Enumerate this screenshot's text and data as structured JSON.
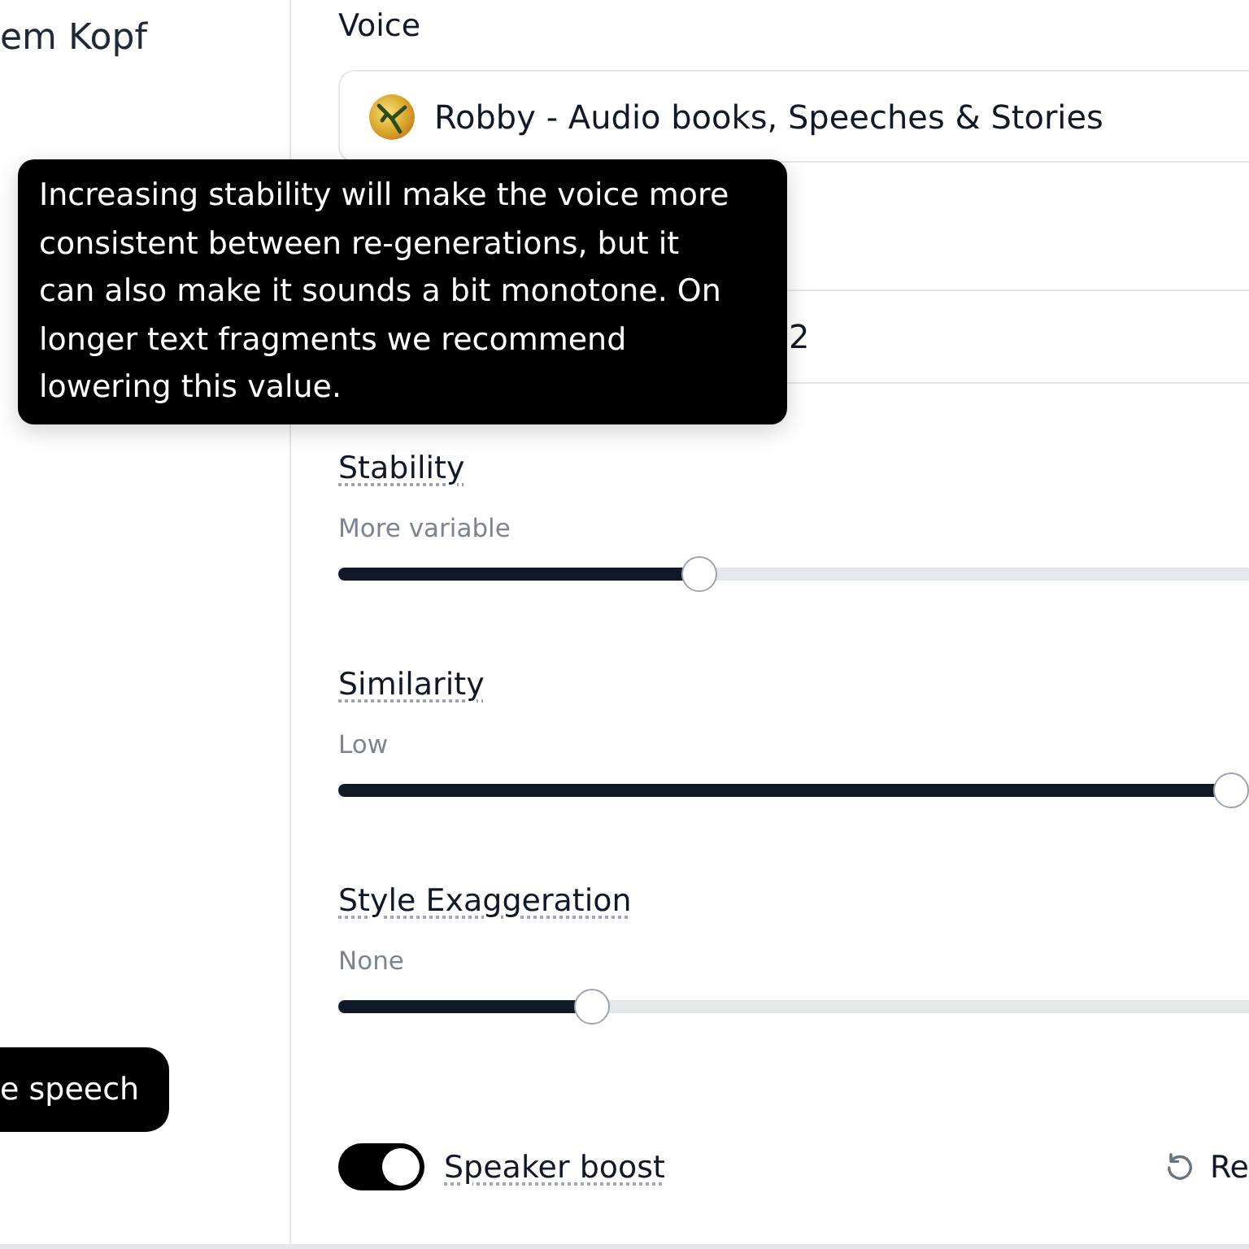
{
  "sidebar": {
    "heading": "em Kopf",
    "button": "e speech"
  },
  "voice": {
    "label": "Voice",
    "value": "Robby - Audio books, Speeches & Stories"
  },
  "model_field": {
    "value": "2"
  },
  "sliders": [
    {
      "label": "Stability",
      "hint": "More variable",
      "level": 0.392
    },
    {
      "label": "Similarity",
      "hint": "Low",
      "level": 1
    },
    {
      "label": "Style Exaggeration",
      "hint": "None",
      "level": 0.27
    }
  ],
  "speaker_boost": {
    "label": "Speaker boost",
    "on": true
  },
  "reset_button": {
    "label": "Re"
  },
  "tooltip": {
    "text": "Increasing stability will make the voice more\nconsistent between re-generations, but it\ncan also make it sounds a bit monotone. On\nlonger text fragments we recommend\nlowering this value."
  }
}
